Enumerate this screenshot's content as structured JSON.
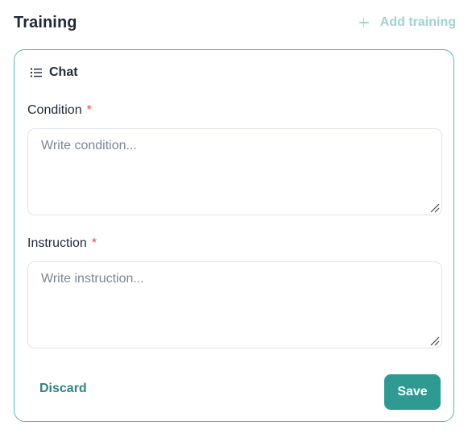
{
  "header": {
    "title": "Training",
    "add_training_label": "Add training"
  },
  "card": {
    "type_label": "Chat",
    "type_icon": "list-icon",
    "accent_color": "#5bb9b0",
    "condition": {
      "label": "Condition",
      "required_marker": "*",
      "placeholder": "Write condition...",
      "value": ""
    },
    "instruction": {
      "label": "Instruction",
      "required_marker": "*",
      "placeholder": "Write instruction...",
      "value": ""
    },
    "discard_label": "Discard",
    "save_label": "Save",
    "save_color": "#2e9a91"
  }
}
